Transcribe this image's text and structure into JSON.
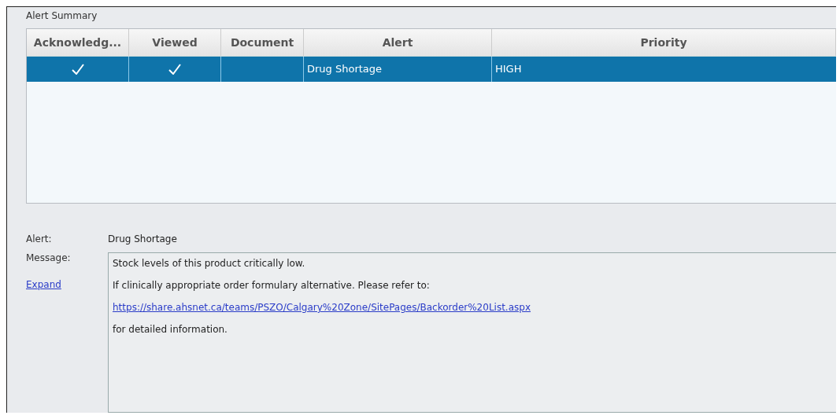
{
  "group_title": "Alert Summary",
  "table": {
    "columns": [
      "Acknowledg...",
      "Viewed",
      "Document",
      "Alert",
      "Priority"
    ],
    "rows": [
      {
        "selected": true,
        "acknowledged": true,
        "viewed": true,
        "document": "",
        "alert": "Drug Shortage",
        "priority": "HIGH"
      }
    ]
  },
  "details": {
    "alert_label": "Alert:",
    "alert_value": "Drug Shortage",
    "message_label": "Message:",
    "expand_link": "Expand",
    "message_lines": [
      {
        "kind": "text",
        "text": "Stock levels of this product critically low."
      },
      {
        "kind": "text",
        "text": "If clinically appropriate order formulary alternative. Please refer to:"
      },
      {
        "kind": "link",
        "text": "https://share.ahsnet.ca/teams/PSZO/Calgary%20Zone/SitePages/Backorder%20List.aspx"
      },
      {
        "kind": "text",
        "text": "for detailed information."
      }
    ]
  }
}
